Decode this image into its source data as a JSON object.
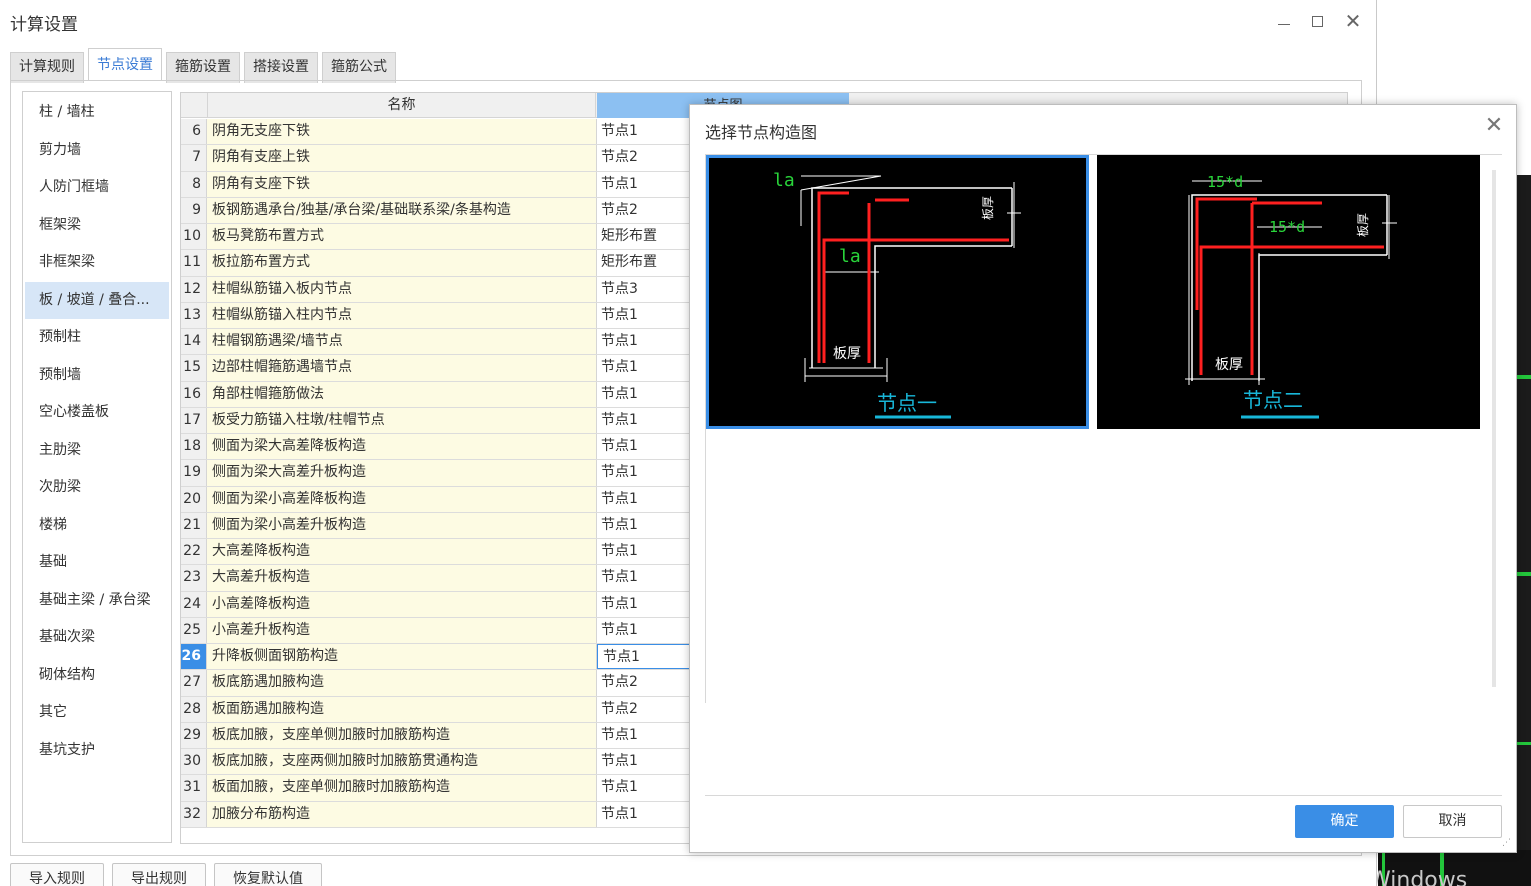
{
  "window": {
    "title": "计算设置",
    "min_icon": "minimize-icon",
    "max_icon": "maximize-icon",
    "close_icon": "close-icon"
  },
  "tabs": [
    {
      "label": "计算规则",
      "active": false
    },
    {
      "label": "节点设置",
      "active": true
    },
    {
      "label": "箍筋设置",
      "active": false
    },
    {
      "label": "搭接设置",
      "active": false
    },
    {
      "label": "箍筋公式",
      "active": false
    }
  ],
  "categories": [
    "柱 / 墙柱",
    "剪力墙",
    "人防门框墙",
    "框架梁",
    "非框架梁",
    "板 / 坡道 / 叠合...",
    "预制柱",
    "预制墙",
    "空心楼盖板",
    "主肋梁",
    "次肋梁",
    "楼梯",
    "基础",
    "基础主梁 / 承台梁",
    "基础次梁",
    "砌体结构",
    "其它",
    "基坑支护"
  ],
  "active_category_index": 5,
  "table": {
    "header_name": "名称",
    "header_node": "节点图",
    "selected_row_number": "26",
    "rows": [
      {
        "no": "6",
        "name": "阴角无支座下铁",
        "node": "节点1"
      },
      {
        "no": "7",
        "name": "阴角有支座上铁",
        "node": "节点2"
      },
      {
        "no": "8",
        "name": "阴角有支座下铁",
        "node": "节点1"
      },
      {
        "no": "9",
        "name": "板钢筋遇承台/独基/承台梁/基础联系梁/条基构造",
        "node": "节点2"
      },
      {
        "no": "10",
        "name": "板马凳筋布置方式",
        "node": "矩形布置"
      },
      {
        "no": "11",
        "name": "板拉筋布置方式",
        "node": "矩形布置"
      },
      {
        "no": "12",
        "name": "柱帽纵筋锚入板内节点",
        "node": "节点3"
      },
      {
        "no": "13",
        "name": "柱帽纵筋锚入柱内节点",
        "node": "节点1"
      },
      {
        "no": "14",
        "name": "柱帽钢筋遇梁/墙节点",
        "node": "节点1"
      },
      {
        "no": "15",
        "name": "边部柱帽箍筋遇墙节点",
        "node": "节点1"
      },
      {
        "no": "16",
        "name": "角部柱帽箍筋做法",
        "node": "节点1"
      },
      {
        "no": "17",
        "name": "板受力筋锚入柱墩/柱帽节点",
        "node": "节点1"
      },
      {
        "no": "18",
        "name": "侧面为梁大高差降板构造",
        "node": "节点1"
      },
      {
        "no": "19",
        "name": "侧面为梁大高差升板构造",
        "node": "节点1"
      },
      {
        "no": "20",
        "name": "侧面为梁小高差降板构造",
        "node": "节点1"
      },
      {
        "no": "21",
        "name": "侧面为梁小高差升板构造",
        "node": "节点1"
      },
      {
        "no": "22",
        "name": "大高差降板构造",
        "node": "节点1"
      },
      {
        "no": "23",
        "name": "大高差升板构造",
        "node": "节点1"
      },
      {
        "no": "24",
        "name": "小高差降板构造",
        "node": "节点1"
      },
      {
        "no": "25",
        "name": "小高差升板构造",
        "node": "节点1"
      },
      {
        "no": "26",
        "name": "升降板侧面钢筋构造",
        "node": "节点1"
      },
      {
        "no": "27",
        "name": "板底筋遇加腋构造",
        "node": "节点2"
      },
      {
        "no": "28",
        "name": "板面筋遇加腋构造",
        "node": "节点2"
      },
      {
        "no": "29",
        "name": "板底加腋，支座单侧加腋时加腋筋构造",
        "node": "节点1"
      },
      {
        "no": "30",
        "name": "板底加腋，支座两侧加腋时加腋筋贯通构造",
        "node": "节点1"
      },
      {
        "no": "31",
        "name": "板面加腋，支座单侧加腋时加腋筋构造",
        "node": "节点1"
      },
      {
        "no": "32",
        "name": "加腋分布筋构造",
        "node": "节点1"
      }
    ]
  },
  "bottom_buttons": {
    "import": "导入规则",
    "export": "导出规则",
    "restore": "恢复默认值"
  },
  "dialog": {
    "title": "选择节点构造图",
    "close_icon": "close-icon",
    "thumbnails": [
      {
        "caption": "节点一",
        "labels": [
          "la",
          "la",
          "板厚",
          "板厚"
        ],
        "selected": true
      },
      {
        "caption": "节点二",
        "labels": [
          "15*d",
          "15*d",
          "板厚",
          "板厚"
        ],
        "selected": false
      }
    ],
    "ok_label": "确定",
    "cancel_label": "取消"
  },
  "background": {
    "watermark": "激活 Windows"
  },
  "colors": {
    "accent": "#3a8ee6",
    "rebar": "#ff2020",
    "dimension": "#ffffff",
    "label_green": "#29d43a",
    "caption_cyan": "#18b7d9"
  }
}
